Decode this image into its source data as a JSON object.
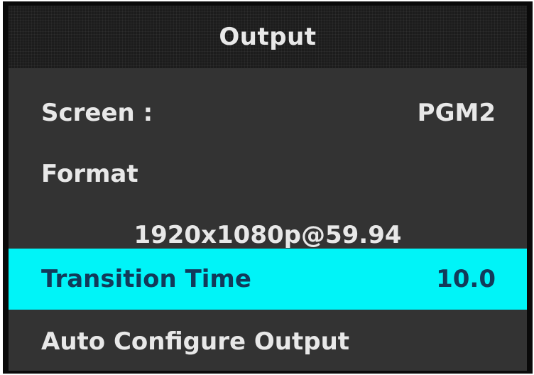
{
  "header": {
    "title": "Output"
  },
  "menu": {
    "screen_label": "Screen :",
    "screen_value": "PGM2",
    "format_label": "Format",
    "format_value": "1920x1080p@59.94",
    "transition_label": "Transition Time",
    "transition_value": "10.0",
    "auto_configure_label": "Auto Configure Output"
  },
  "colors": {
    "panel_background": "#333333",
    "header_background": "#1c1c1c",
    "selected_highlight": "#00f4f8",
    "selected_text": "#123a5a",
    "text": "#e8e8e8"
  }
}
